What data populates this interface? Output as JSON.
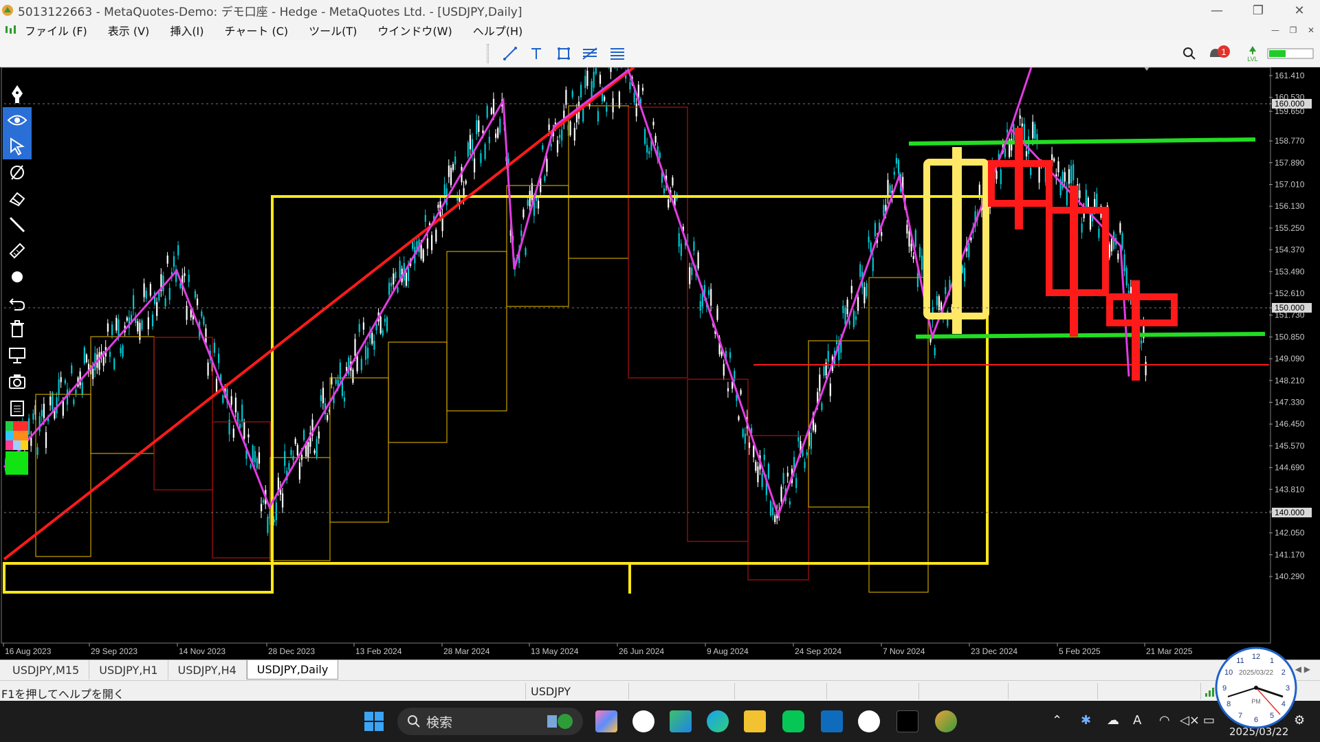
{
  "window": {
    "title": "5013122663 - MetaQuotes-Demo: デモ口座 - Hedge - MetaQuotes Ltd. - [USDJPY,Daily]",
    "controls": [
      "—",
      "❐",
      "✕"
    ]
  },
  "menu": {
    "items": [
      "ファイル (F)",
      "表示 (V)",
      "挿入(I)",
      "チャート (C)",
      "ツール(T)",
      "ウインドウ(W)",
      "ヘルプ(H)"
    ]
  },
  "toolbar": {
    "tools": [
      "trendline-icon",
      "text-icon",
      "rectangle-icon",
      "fibonacci-icon",
      "channel-icon"
    ],
    "notification_count": "1",
    "lvl_label": "LVL"
  },
  "chart": {
    "symbol": "USDJPY",
    "timeframe": "Daily",
    "background": "#000000",
    "price_labels": [
      "161.410",
      "160.530",
      "160.000",
      "159.650",
      "158.770",
      "157.890",
      "157.010",
      "156.130",
      "155.250",
      "154.370",
      "153.490",
      "152.610",
      "151.730",
      "150.850",
      "150.000",
      "149.090",
      "148.210",
      "147.330",
      "146.450",
      "145.570",
      "144.690",
      "143.810",
      "142.930",
      "142.050",
      "141.170",
      "140.290",
      "140.000"
    ],
    "highlighted_prices": [
      "160.000",
      "150.000",
      "140.000"
    ],
    "date_labels": [
      "16 Aug 2023",
      "29 Sep 2023",
      "14 Nov 2023",
      "28 Dec 2023",
      "13 Feb 2024",
      "28 Mar 2024",
      "13 May 2024",
      "26 Jun 2024",
      "9 Aug 2024",
      "24 Sep 2024",
      "7 Nov 2024",
      "23 Dec 2024",
      "5 Feb 2025",
      "21 Mar 2025"
    ],
    "colors": {
      "bull_candle": "#ffffff",
      "bear_candle": "#00c8d2",
      "zigzag": "#e23be2",
      "trend_red": "#ff1a1a",
      "range_yellow": "#ffe81a",
      "support_green": "#22dd22",
      "box_orange": "#c8a000",
      "box_darkred": "#b01010"
    }
  },
  "left_toolbar": {
    "tools": [
      "pen-icon",
      "eye-icon",
      "cursor-icon",
      "compass-icon",
      "eraser-icon",
      "line-icon",
      "ruler-icon",
      "dot-icon",
      "undo-icon",
      "trash-icon",
      "presentation-icon",
      "camera-icon",
      "clipboard-icon",
      "color-palette-icon",
      "color-swatch-icon"
    ]
  },
  "tabs": [
    "USDJPY,M15",
    "USDJPY,H1",
    "USDJPY,H4",
    "USDJPY,Daily"
  ],
  "active_tab": "USDJPY,Daily",
  "status": {
    "help": "F1を押してヘルプを開く",
    "symbol": "USDJPY"
  },
  "taskbar": {
    "search_placeholder": "検索",
    "date": "2025/03/22",
    "clock_date": "2025/03/22",
    "clock_pm": "PM"
  }
}
